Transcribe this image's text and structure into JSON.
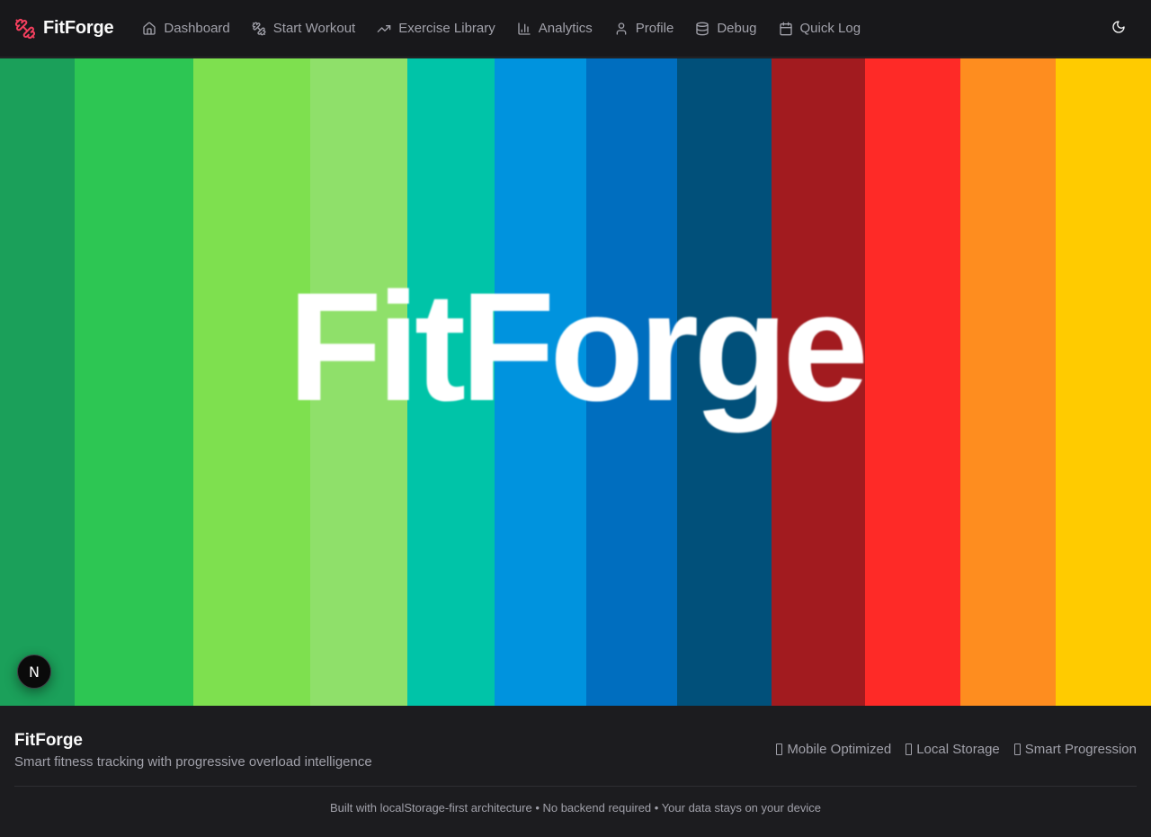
{
  "app": {
    "name": "FitForge",
    "logo_icon": "dumbbell-icon",
    "accent_color": "#f43f5e"
  },
  "nav": {
    "items": [
      {
        "label": "Dashboard",
        "icon": "home-icon"
      },
      {
        "label": "Start Workout",
        "icon": "dumbbell-icon"
      },
      {
        "label": "Exercise Library",
        "icon": "trending-up-icon"
      },
      {
        "label": "Analytics",
        "icon": "bar-chart-icon"
      },
      {
        "label": "Profile",
        "icon": "user-icon"
      },
      {
        "label": "Debug",
        "icon": "database-icon"
      },
      {
        "label": "Quick Log",
        "icon": "calendar-icon"
      }
    ],
    "theme_toggle_icon": "moon-icon"
  },
  "hero": {
    "logo_text": "FitForge",
    "stripe_colors": [
      "#1ba05a",
      "#2dc653",
      "#7ee04f",
      "#8fe06a",
      "#00c4a8",
      "#0093de",
      "#006ebf",
      "#01507a",
      "#a21b1f",
      "#fe2a27",
      "#fe8d1f",
      "#ffcb00"
    ]
  },
  "dev_badge": {
    "label": "N",
    "icon": "nextjs-icon"
  },
  "footer": {
    "title": "FitForge",
    "tagline": "Smart fitness tracking with progressive overload intelligence",
    "features": [
      "Mobile Optimized",
      "Local Storage",
      "Smart Progression"
    ],
    "note": "Built with localStorage-first architecture • No backend required • Your data stays on your device"
  }
}
